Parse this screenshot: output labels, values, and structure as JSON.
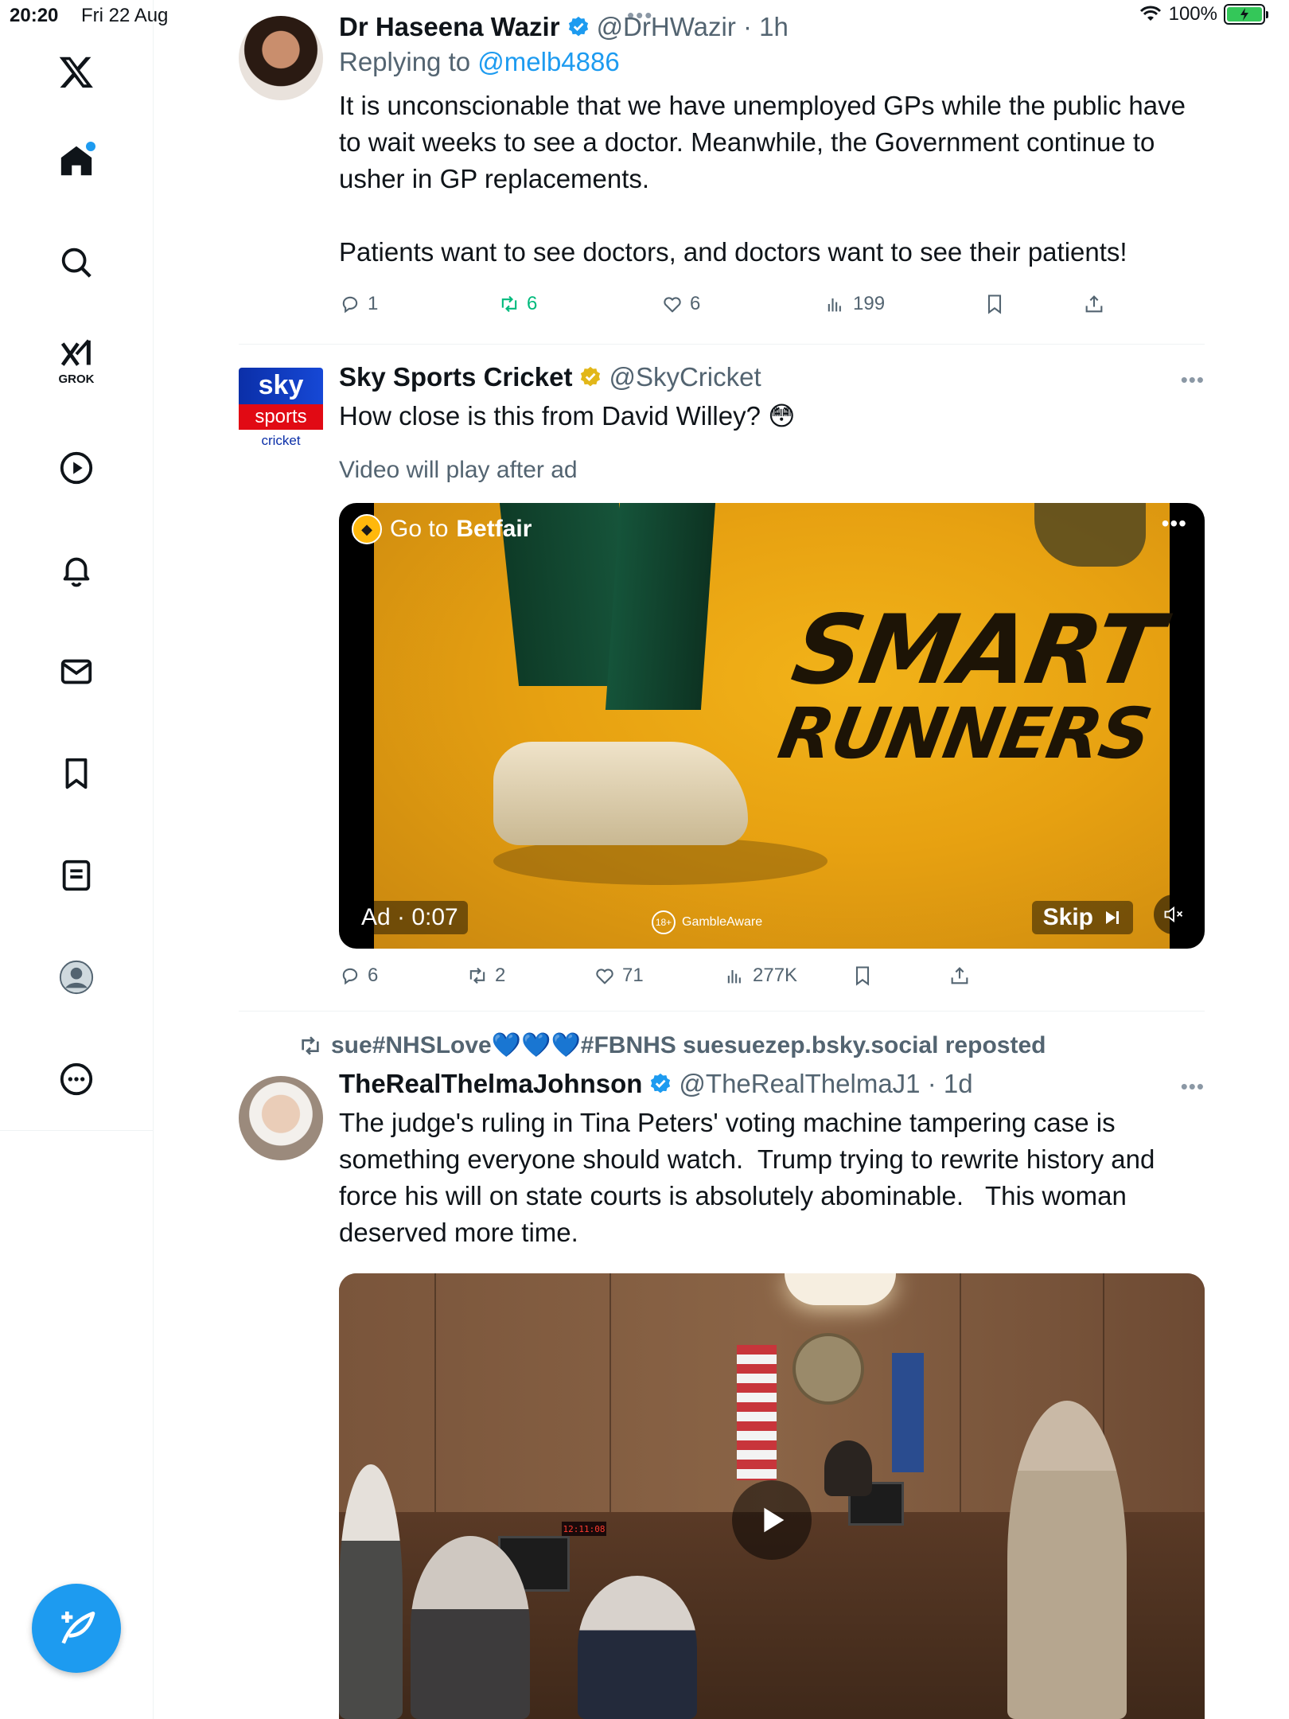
{
  "status_bar": {
    "time": "20:20",
    "date": "Fri 22 Aug",
    "battery": "100%"
  },
  "sidebar": {
    "items": [
      {
        "label": "Home",
        "icon": "home-icon"
      },
      {
        "label": "Search",
        "icon": "search-icon"
      },
      {
        "label": "GROK",
        "icon": "grok-icon"
      },
      {
        "label": "Video",
        "icon": "play-icon"
      },
      {
        "label": "Notifications",
        "icon": "bell-icon"
      },
      {
        "label": "Messages",
        "icon": "mail-icon"
      },
      {
        "label": "Bookmarks",
        "icon": "bookmark-icon"
      },
      {
        "label": "Lists",
        "icon": "list-icon"
      },
      {
        "label": "Profile",
        "icon": "profile-icon"
      },
      {
        "label": "More",
        "icon": "more-icon"
      }
    ],
    "grok_label": "GROK"
  },
  "tweets": [
    {
      "name": "Dr Haseena Wazir",
      "handle": "@DrHWazir",
      "time": "1h",
      "replying_to_prefix": "Replying to",
      "replying_to": "@melb4886",
      "text": "It is unconscionable that we have unemployed GPs while the public have to wait weeks to see a doctor. Meanwhile, the Government continue to usher in GP replacements.\n\nPatients want to see doctors, and doctors want to see their patients!",
      "replies": "1",
      "reposts": "6",
      "likes": "6",
      "views": "199"
    },
    {
      "name": "Sky Sports Cricket",
      "handle": "@SkyCricket",
      "text": "How close is this from David Willey? 😳",
      "ad_note": "Video will play after ad",
      "ad": {
        "go_to_prefix": "Go to",
        "go_to_brand": "Betfair",
        "headline_1": "SMART",
        "headline_2": "RUNNERS",
        "ad_time": "Ad · 0:07",
        "gamble_age": "18+",
        "gamble_label": "GambleAware",
        "skip_label": "Skip"
      },
      "avatar": {
        "line1": "sky",
        "line2": "sports",
        "line3": "cricket"
      },
      "replies": "6",
      "reposts": "2",
      "likes": "71",
      "views": "277K"
    },
    {
      "reposted_by": "sue#NHSLove💙💙💙#FBNHS suesuezep.bsky.social reposted",
      "name": "TheRealThelmaJohnson",
      "handle": "@TheRealThelmaJ1",
      "time": "1d",
      "text": "The judge's ruling in Tina Peters' voting machine tampering case is something everyone should watch.  Trump trying to rewrite history and force his will on state courts is absolutely abominable.   This woman deserved more time.",
      "video_clock": "12:11:08"
    }
  ],
  "colors": {
    "accent": "#1d9bf0",
    "repost_active": "#00ba7c",
    "secondary_text": "#536471",
    "verified_gold": "#e2b719"
  }
}
